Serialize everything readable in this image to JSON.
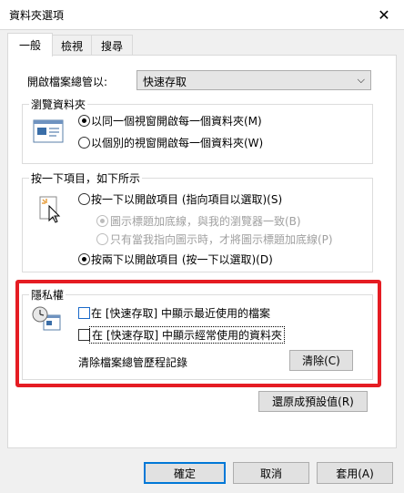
{
  "window": {
    "title": "資料夾選項",
    "close_glyph": "✕"
  },
  "tabs": [
    {
      "label": "一般"
    },
    {
      "label": "檢視"
    },
    {
      "label": "搜尋"
    }
  ],
  "general": {
    "open_explorer_label": "開啟檔案總管以:",
    "open_explorer_value": "快速存取",
    "browse": {
      "title": "瀏覽資料夾",
      "options": [
        {
          "label": "以同一個視窗開啟每一個資料夾(M)",
          "checked": true
        },
        {
          "label": "以個別的視窗開啟每一個資料夾(W)",
          "checked": false
        }
      ]
    },
    "click": {
      "title": "按一下項目，如下所示",
      "single": "按一下以開啟項目 (指向項目以選取)(S)",
      "underline_browser": "圖示標題加底線，與我的瀏覽器一致(B)",
      "underline_point": "只有當我指向圖示時，才將圖示標題加底線(P)",
      "double": "按兩下以開啟項目 (按一下以選取)(D)"
    },
    "privacy": {
      "title": "隱私權",
      "recent_files": "在 [快速存取] 中顯示最近使用的檔案",
      "frequent_folders": "在 [快速存取] 中顯示經常使用的資料夾",
      "clear_label": "清除檔案總管歷程記錄",
      "clear_button": "清除(C)"
    },
    "restore_button": "還原成預設值(R)"
  },
  "footer": {
    "ok": "確定",
    "cancel": "取消",
    "apply": "套用(A)"
  },
  "colors": {
    "highlight": "#e51c23",
    "accent": "#0078d7"
  }
}
